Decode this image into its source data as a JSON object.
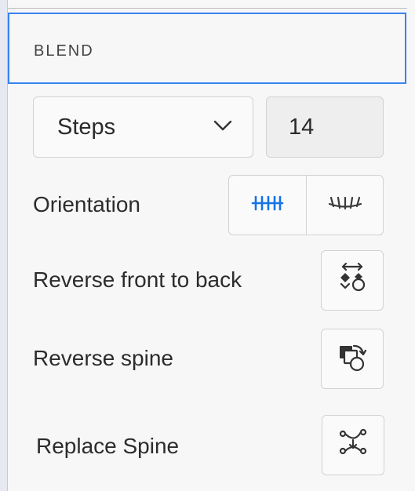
{
  "panel": {
    "title": "BLEND"
  },
  "steps": {
    "mode": "Steps",
    "value": "14"
  },
  "orientation": {
    "label": "Orientation",
    "options": [
      "align-to-page-icon",
      "align-to-path-icon"
    ],
    "selected_color": "#1473e6"
  },
  "actions": {
    "reverse_front_to_back": "Reverse front to back",
    "reverse_spine": "Reverse spine",
    "replace_spine": "Replace Spine"
  }
}
